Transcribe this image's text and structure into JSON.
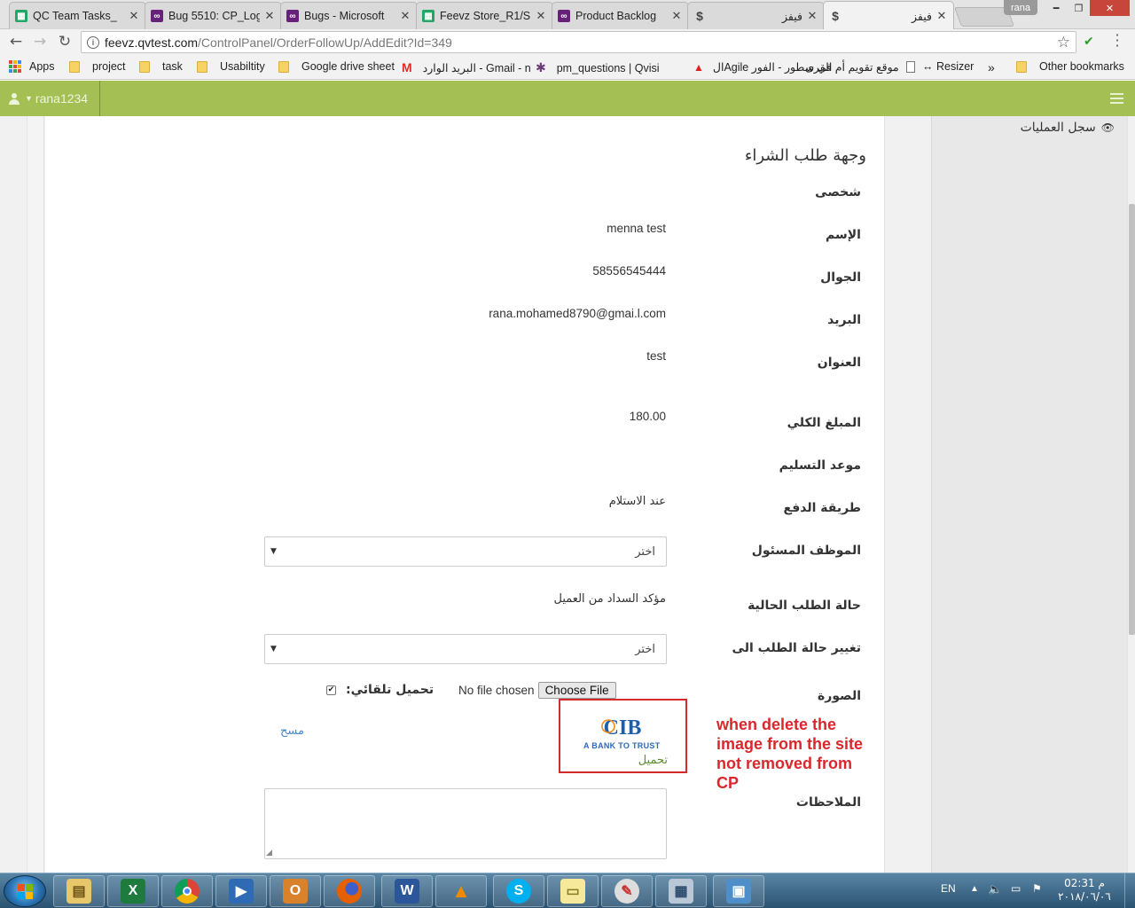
{
  "browser": {
    "tabs": [
      {
        "label": "QC Team Tasks_",
        "icon": "sheets-icon",
        "color": "#23a566",
        "active": false
      },
      {
        "label": "Bug 5510: CP_Log",
        "icon": "visual-studio-icon",
        "color": "#68217a",
        "active": false
      },
      {
        "label": "Bugs - Microsoft",
        "icon": "visual-studio-icon",
        "color": "#68217a",
        "active": false
      },
      {
        "label": "Feevz Store_R1/S",
        "icon": "sheets-icon",
        "color": "#23a566",
        "active": false
      },
      {
        "label": "Product Backlog",
        "icon": "visual-studio-icon",
        "color": "#68217a",
        "active": false
      },
      {
        "label": "فيفز",
        "icon": "dollar-icon",
        "color": "#555555",
        "active": false
      },
      {
        "label": "فيفز",
        "icon": "dollar-icon",
        "color": "#555555",
        "active": true
      }
    ],
    "profile_name": "rana",
    "address": {
      "host": "feevz.qvtest.com",
      "path": "/ControlPanel/OrderFollowUp/AddEdit?Id=349"
    },
    "bookmarks": [
      {
        "label": "Apps",
        "icon": "apps-grid-icon"
      },
      {
        "label": "project",
        "icon": "folder-icon"
      },
      {
        "label": "task",
        "icon": "folder-icon"
      },
      {
        "label": "Usabiltity",
        "icon": "folder-icon"
      },
      {
        "label": "Google drive sheet",
        "icon": "folder-icon"
      },
      {
        "label": "البريد الوارد - Gmail - n",
        "icon": "gmail-icon"
      },
      {
        "label": "pm_questions | Qvisi",
        "icon": "slack-icon"
      },
      {
        "label": "الAgile في سطور - الفور",
        "icon": "acrobat-icon"
      },
      {
        "label": "موقع تقويم أم القرى",
        "icon": "page-icon"
      },
      {
        "label": "↔ Resizer",
        "icon": "resizer-icon"
      },
      {
        "label": "»",
        "icon": "more-icon"
      },
      {
        "label": "Other bookmarks",
        "icon": "folder-icon"
      }
    ]
  },
  "site": {
    "username": "rana1234",
    "accent": "#a4c054",
    "sidebar_item": "سجل العمليات"
  },
  "order": {
    "title": "وجهة طلب الشراء",
    "section_personal": "شخصى",
    "fields": [
      {
        "label": "الإسم",
        "value": "menna test"
      },
      {
        "label": "الجوال",
        "value": "58556545444"
      },
      {
        "label": "البريد",
        "value": "rana.mohamed8790@gmai.l.com"
      },
      {
        "label": "العنوان",
        "value": "test"
      },
      {
        "label": "المبلغ الكلي",
        "value": "180.00"
      },
      {
        "label": "موعد التسليم",
        "value": ""
      },
      {
        "label": "طريقة الدفع",
        "value": "عند الاستلام"
      }
    ],
    "employee_label": "الموظف المسئول",
    "employee_select": "اختر",
    "current_status_label": "حالة الطلب الحالية",
    "current_status_value": "مؤكد السداد من العميل",
    "change_status_label": "تغيير حالة الطلب الى",
    "change_status_select": "اختر",
    "image_label": "الصورة",
    "file_status": "No file chosen",
    "file_button": "Choose File",
    "auto_upload_label": "تحميل تلقائي:",
    "auto_upload_checked": true,
    "delete_link": "مسح",
    "logo_text": "CIB",
    "logo_tagline": "A BANK TO TRUST",
    "upload_link": "تحميل",
    "notes_label": "الملاحظات"
  },
  "annotation": "when delete the image from the site not removed from CP",
  "taskbar": {
    "apps": [
      "explorer-icon",
      "excel-icon",
      "chrome-icon",
      "media-player-icon",
      "outlook-icon",
      "firefox-icon",
      "word-icon",
      "vlc-icon",
      "skype-icon",
      "sticky-notes-icon",
      "paint-icon",
      "calculator-icon",
      "photo-viewer-icon"
    ],
    "language": "EN",
    "time": "02:31 م",
    "date": "٢٠١٨/٠٦/٠٦"
  }
}
